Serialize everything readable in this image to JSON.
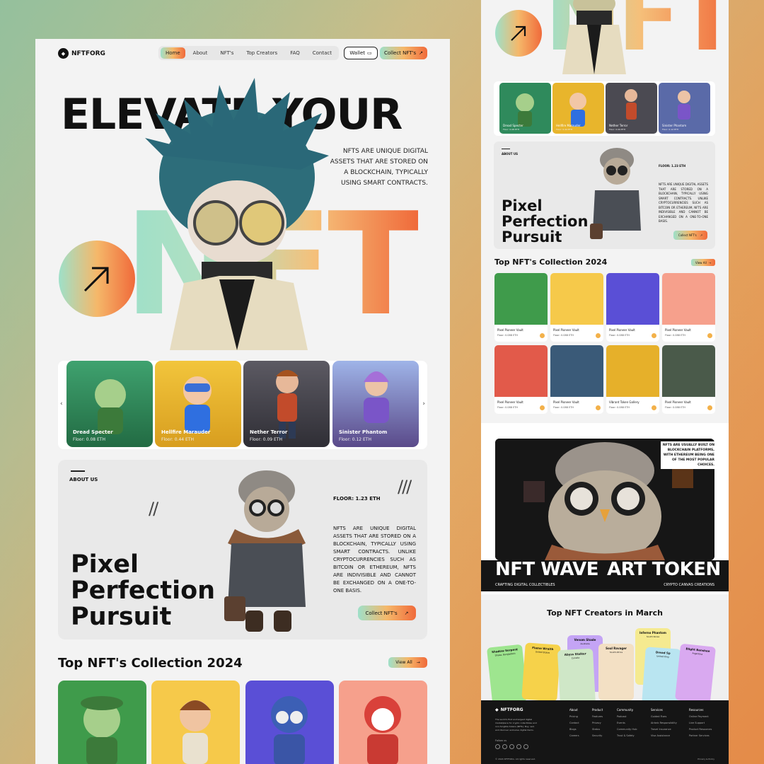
{
  "brand": "NFTFORG",
  "nav": {
    "items": [
      "Home",
      "About",
      "NFT's",
      "Top Creators",
      "FAQ",
      "Contact"
    ],
    "wallet": "Wallet",
    "collect": "Collect NFT's"
  },
  "hero": {
    "title": "ELEVATE YOUR",
    "desc": "NFTS ARE UNIQUE DIGITAL ASSETS THAT ARE STORED ON A BLOCKCHAIN, TYPICALLY USING SMART CONTRACTS.",
    "big": "NFT"
  },
  "featured": [
    {
      "name": "Dread Specter",
      "floor": "Floor: 0.08 ETH",
      "color": "#2f8a5c"
    },
    {
      "name": "Hellfire Marauder",
      "floor": "Floor: 0.44 ETH",
      "color": "#e8b52c"
    },
    {
      "name": "Nether Terror",
      "floor": "Floor: 0.09 ETH",
      "color": "#4b4a52"
    },
    {
      "name": "Sinister Phantom",
      "floor": "Floor: 0.12 ETH",
      "color": "#5a6aa8"
    }
  ],
  "about": {
    "label": "ABOUT US",
    "floor": "FLOOR: 1.23 ETH",
    "text": "NFTS ARE UNIQUE DIGITAL ASSETS THAT ARE STORED ON A BLOCKCHAIN, TYPICALLY USING SMART CONTRACTS. UNLIKE CRYPTOCURRENCIES SUCH AS BITCOIN OR ETHEREUM, NFTS ARE INDIVISIBLE AND CANNOT BE EXCHANGED ON A ONE-TO-ONE BASIS.",
    "line1": "Pixel",
    "line2": "Perfection",
    "line3": "Pursuit",
    "collect": "Collect NFT's"
  },
  "collection": {
    "title": "Top NFT's Collection 2024",
    "view_all": "View All",
    "items": [
      {
        "name": "Pixel Pioneer Vault",
        "price": "Floor: 0.088 ETH",
        "color": "#3f9b4b"
      },
      {
        "name": "Pixel Pioneer Vault",
        "price": "Floor: 0.088 ETH",
        "color": "#f6c94a"
      },
      {
        "name": "Pixel Pioneer Vault",
        "price": "Floor: 0.088 ETH",
        "color": "#5a4fd6"
      },
      {
        "name": "Pixel Pioneer Vault",
        "price": "Floor: 0.088 ETH",
        "color": "#f6a08c"
      },
      {
        "name": "Pixel Pioneer Vault",
        "price": "Floor: 0.088 ETH",
        "color": "#e25a4a"
      },
      {
        "name": "Pixel Pioneer Vault",
        "price": "Floor: 0.088 ETH",
        "color": "#3a5a78"
      },
      {
        "name": "Vibrant Token Gallery",
        "price": "Floor: 0.088 ETH",
        "color": "#e6b02a"
      },
      {
        "name": "Pixel Pioneer Vault",
        "price": "Floor: 0.088 ETH",
        "color": "#4a5a4a"
      }
    ]
  },
  "wave": {
    "note": "NFTS ARE USUALLY BUILT ON BLOCKCHAIN PLATFORMS, WITH ETHEREUM BEING ONE OF THE MOST POPULAR CHOICES.",
    "title1": "NFT WAVE",
    "title2": "ART TOKEN",
    "sub1": "CRAFTING DIGITAL COLLECTIBLES",
    "sub2": "CRYPTO CANVAS CREATIONS"
  },
  "creators": {
    "title": "Top NFT Creators in March",
    "items": [
      {
        "name": "Shadow Serpent",
        "loc": "Dhaka, Bangladesh",
        "color": "#9ee58f"
      },
      {
        "name": "Flame Wraith",
        "loc": "United States",
        "color": "#f6d24a"
      },
      {
        "name": "Venom Shade",
        "loc": "Australia",
        "color": "#c4a4f5"
      },
      {
        "name": "Abyss Stalker",
        "loc": "Canada",
        "color": "#cfe7c7"
      },
      {
        "name": "Soul Ravager",
        "loc": "South Africa",
        "color": "#f3e0c4"
      },
      {
        "name": "Inferno Phantom",
        "loc": "South Korea",
        "color": "#f5ea90"
      },
      {
        "name": "Dread Sp",
        "loc": "United King",
        "color": "#b9e5f1"
      },
      {
        "name": "Blight Banshee",
        "loc": "Argentina",
        "color": "#d9a9f0"
      }
    ]
  },
  "footer": {
    "desc": "The world's first and largest digital marketplace for crypto collectibles and non-fungible tokens (NFTs). Buy, sell, and discover exclusive digital items.",
    "follow": "Follow us",
    "cols": [
      {
        "h": "About",
        "l": [
          "Pricing",
          "Contact",
          "Blogs",
          "Careers"
        ]
      },
      {
        "h": "Product",
        "l": [
          "Features",
          "Privacy",
          "Status",
          "Security"
        ]
      },
      {
        "h": "Community",
        "l": [
          "Podcast",
          "Events",
          "Community Hub",
          "Trust & Safety"
        ]
      },
      {
        "h": "Services",
        "l": [
          "Guided Fixes",
          "Airbnb Responsibility",
          "Travel Insurance",
          "Visa Assistance"
        ]
      },
      {
        "h": "Resources",
        "l": [
          "Online Payment",
          "Live Support",
          "Product Resources",
          "Partner Services"
        ]
      }
    ],
    "copy": "© 2024 NFTFORG. All rights reserved.",
    "policy": "Privacy & Policy"
  }
}
